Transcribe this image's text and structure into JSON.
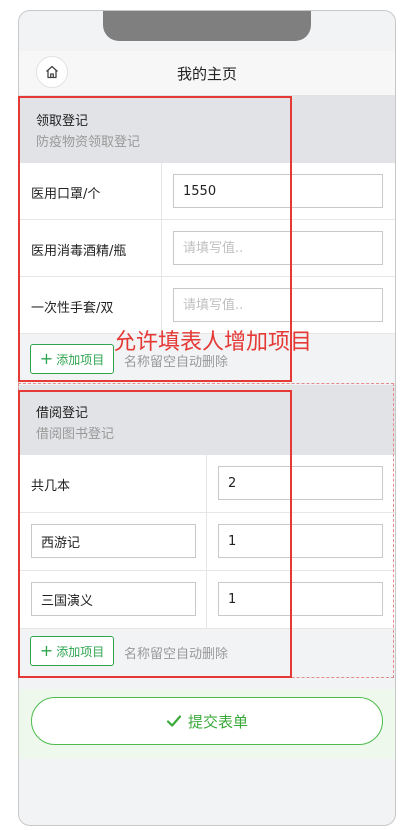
{
  "header": {
    "title": "我的主页",
    "home_icon": "home-icon"
  },
  "section1": {
    "title": "领取登记",
    "subtitle": "防疫物资领取登记",
    "rows": [
      {
        "label": "医用口罩/个",
        "value": "1550",
        "placeholder": ""
      },
      {
        "label": "医用消毒酒精/瓶",
        "value": "",
        "placeholder": "请填写值.."
      },
      {
        "label": "一次性手套/双",
        "value": "",
        "placeholder": "请填写值.."
      }
    ],
    "add_label": "添加项目",
    "hint": "名称留空自动删除"
  },
  "annotation": "允许填表人增加项目",
  "section2": {
    "title": "借阅登记",
    "subtitle": "借阅图书登记",
    "fixed_row": {
      "label": "共几本",
      "value": "2"
    },
    "item_rows": [
      {
        "name": "西游记",
        "value": "1"
      },
      {
        "name": "三国演义",
        "value": "1"
      }
    ],
    "add_label": "添加项目",
    "hint": "名称留空自动删除"
  },
  "submit": {
    "label": "提交表单",
    "icon": "check-icon"
  },
  "colors": {
    "accent_green": "#2ea44f",
    "annotation_red": "#e53935"
  }
}
